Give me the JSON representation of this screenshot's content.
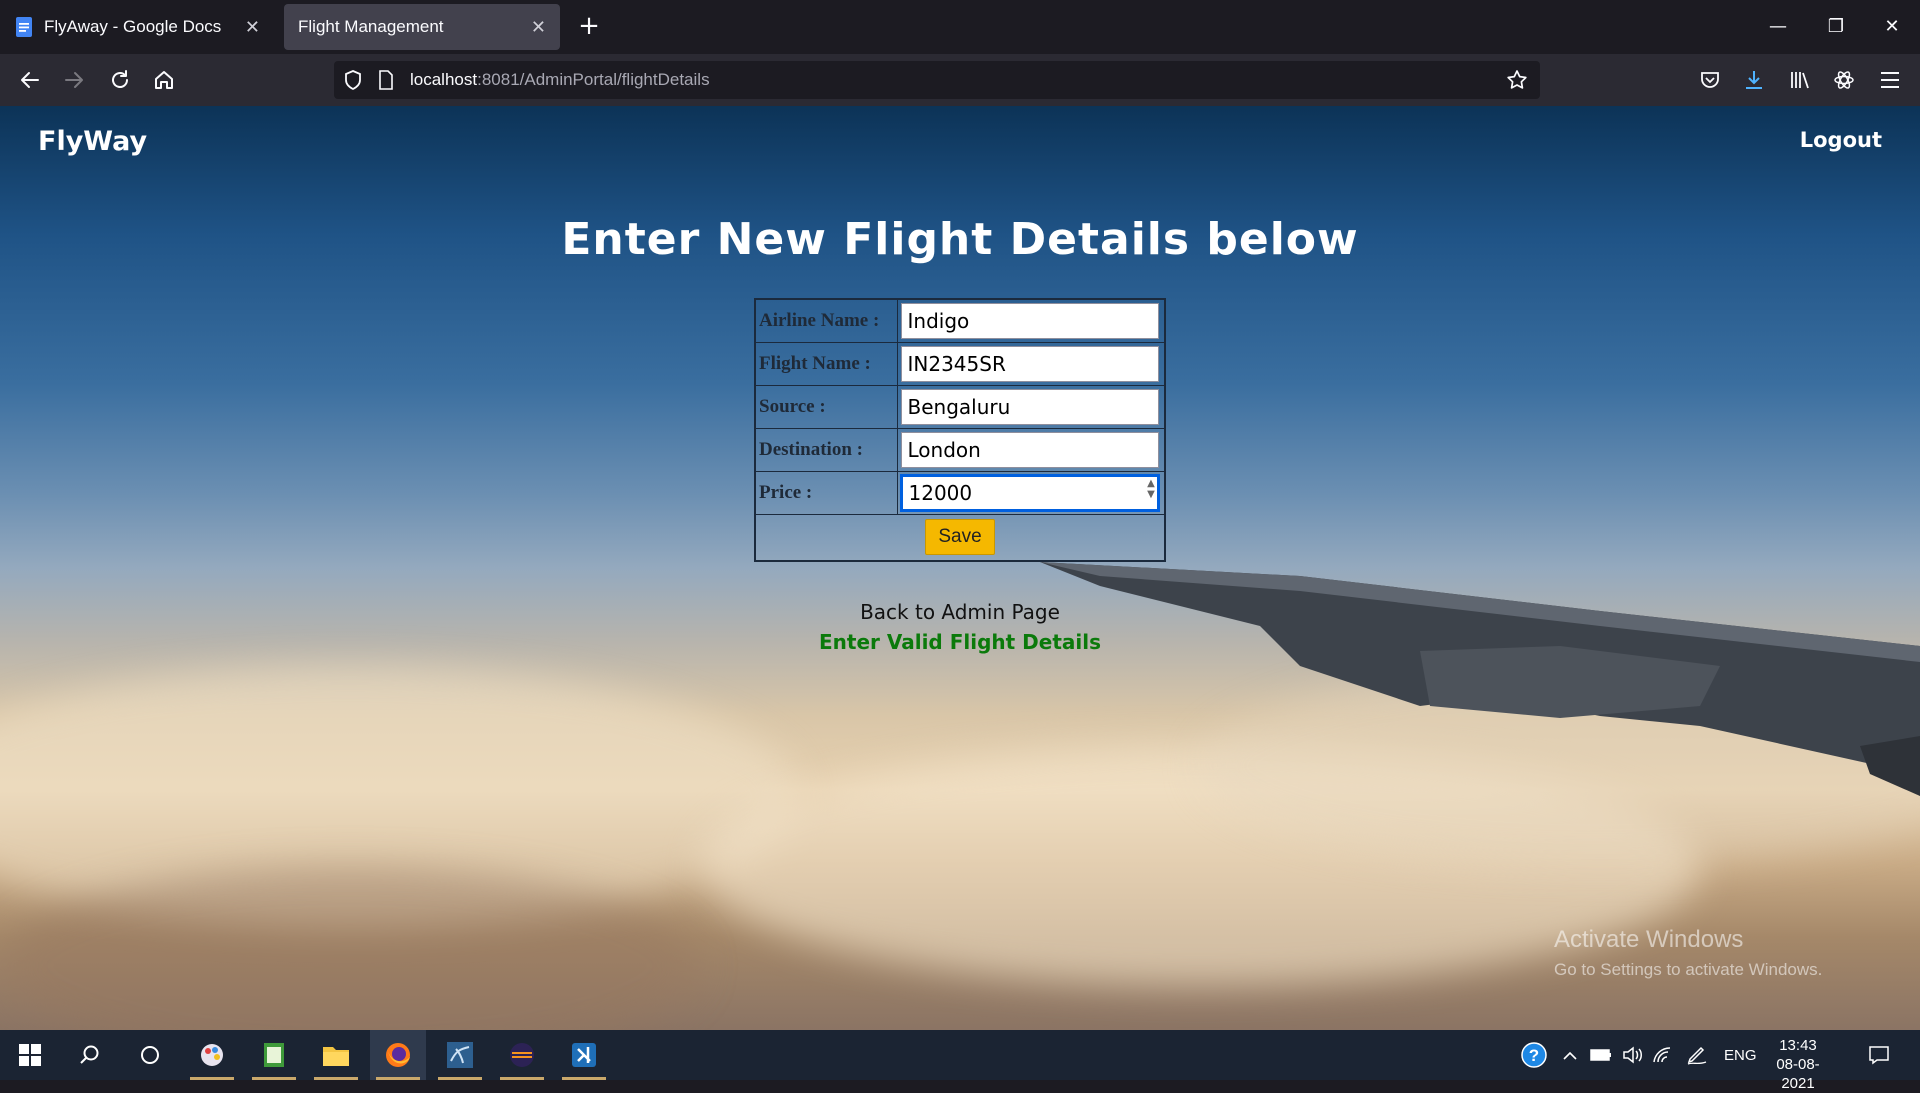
{
  "browser": {
    "tabs": [
      {
        "label": "FlyAway - Google Docs",
        "icon": "google-docs-icon",
        "active": false
      },
      {
        "label": "Flight Management",
        "icon": "",
        "active": true
      }
    ],
    "url_host": "localhost",
    "url_rest": ":8081/AdminPortal/flightDetails"
  },
  "page": {
    "brand": "FlyWay",
    "logout": "Logout",
    "heading": "Enter New Flight Details below",
    "form": {
      "airline_label": "Airline Name :",
      "airline_value": "Indigo",
      "flight_label": "Flight Name :",
      "flight_value": "IN2345SR",
      "source_label": "Source :",
      "source_value": "Bengaluru",
      "destination_label": "Destination :",
      "destination_value": "London",
      "price_label": "Price :",
      "price_value": "12000",
      "save_label": "Save"
    },
    "back_link": "Back to Admin Page",
    "message": "Enter Valid Flight Details",
    "message_color": "#0b7a0b"
  },
  "watermark": {
    "line1": "Activate Windows",
    "line2": "Go to Settings to activate Windows."
  },
  "taskbar": {
    "language": "ENG",
    "time": "13:43",
    "date": "08-08-2021"
  }
}
